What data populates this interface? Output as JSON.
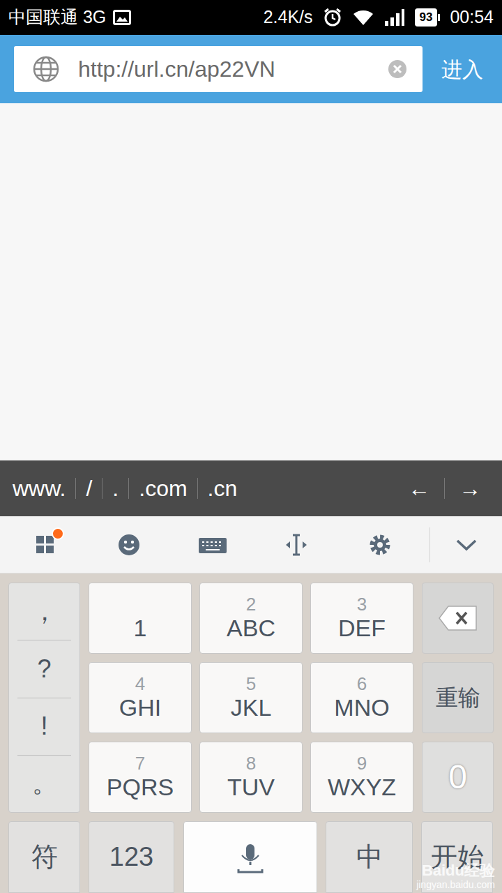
{
  "status_bar": {
    "carrier": "中国联通 3G",
    "speed": "2.4K/s",
    "battery": "93",
    "time": "00:54"
  },
  "url_bar": {
    "value": "http://url.cn/ap22VN",
    "button": "进入"
  },
  "shortcuts": [
    {
      "label": "www.",
      "kind": "insert"
    },
    {
      "label": "/",
      "kind": "insert"
    },
    {
      "label": ".",
      "kind": "insert"
    },
    {
      "label": ".com",
      "kind": "insert"
    },
    {
      "label": ".cn",
      "kind": "insert"
    },
    {
      "label": "←",
      "kind": "cursor"
    },
    {
      "label": "→",
      "kind": "cursor"
    }
  ],
  "toolbar": {
    "notification_dot": true
  },
  "keyboard": {
    "left_column": [
      "，",
      "?",
      "!",
      "。"
    ],
    "keys": [
      {
        "hint": "",
        "label": "1"
      },
      {
        "hint": "2",
        "label": "ABC"
      },
      {
        "hint": "3",
        "label": "DEF"
      },
      {
        "hint": "4",
        "label": "GHI"
      },
      {
        "hint": "5",
        "label": "JKL"
      },
      {
        "hint": "6",
        "label": "MNO"
      },
      {
        "hint": "7",
        "label": "PQRS"
      },
      {
        "hint": "8",
        "label": "TUV"
      },
      {
        "hint": "9",
        "label": "WXYZ"
      }
    ],
    "right_column": [
      {
        "kind": "delete",
        "label": ""
      },
      {
        "kind": "text",
        "label": "重输"
      },
      {
        "kind": "text",
        "label": "0"
      }
    ],
    "bottom_row": [
      {
        "kind": "text",
        "label": "符"
      },
      {
        "kind": "text",
        "label": "123"
      },
      {
        "kind": "mic",
        "label": ""
      },
      {
        "kind": "text",
        "label": "中"
      },
      {
        "kind": "text",
        "label": "开始"
      }
    ]
  },
  "watermark": {
    "logo": "Baidu经验",
    "url": "jingyan.baidu.com"
  }
}
